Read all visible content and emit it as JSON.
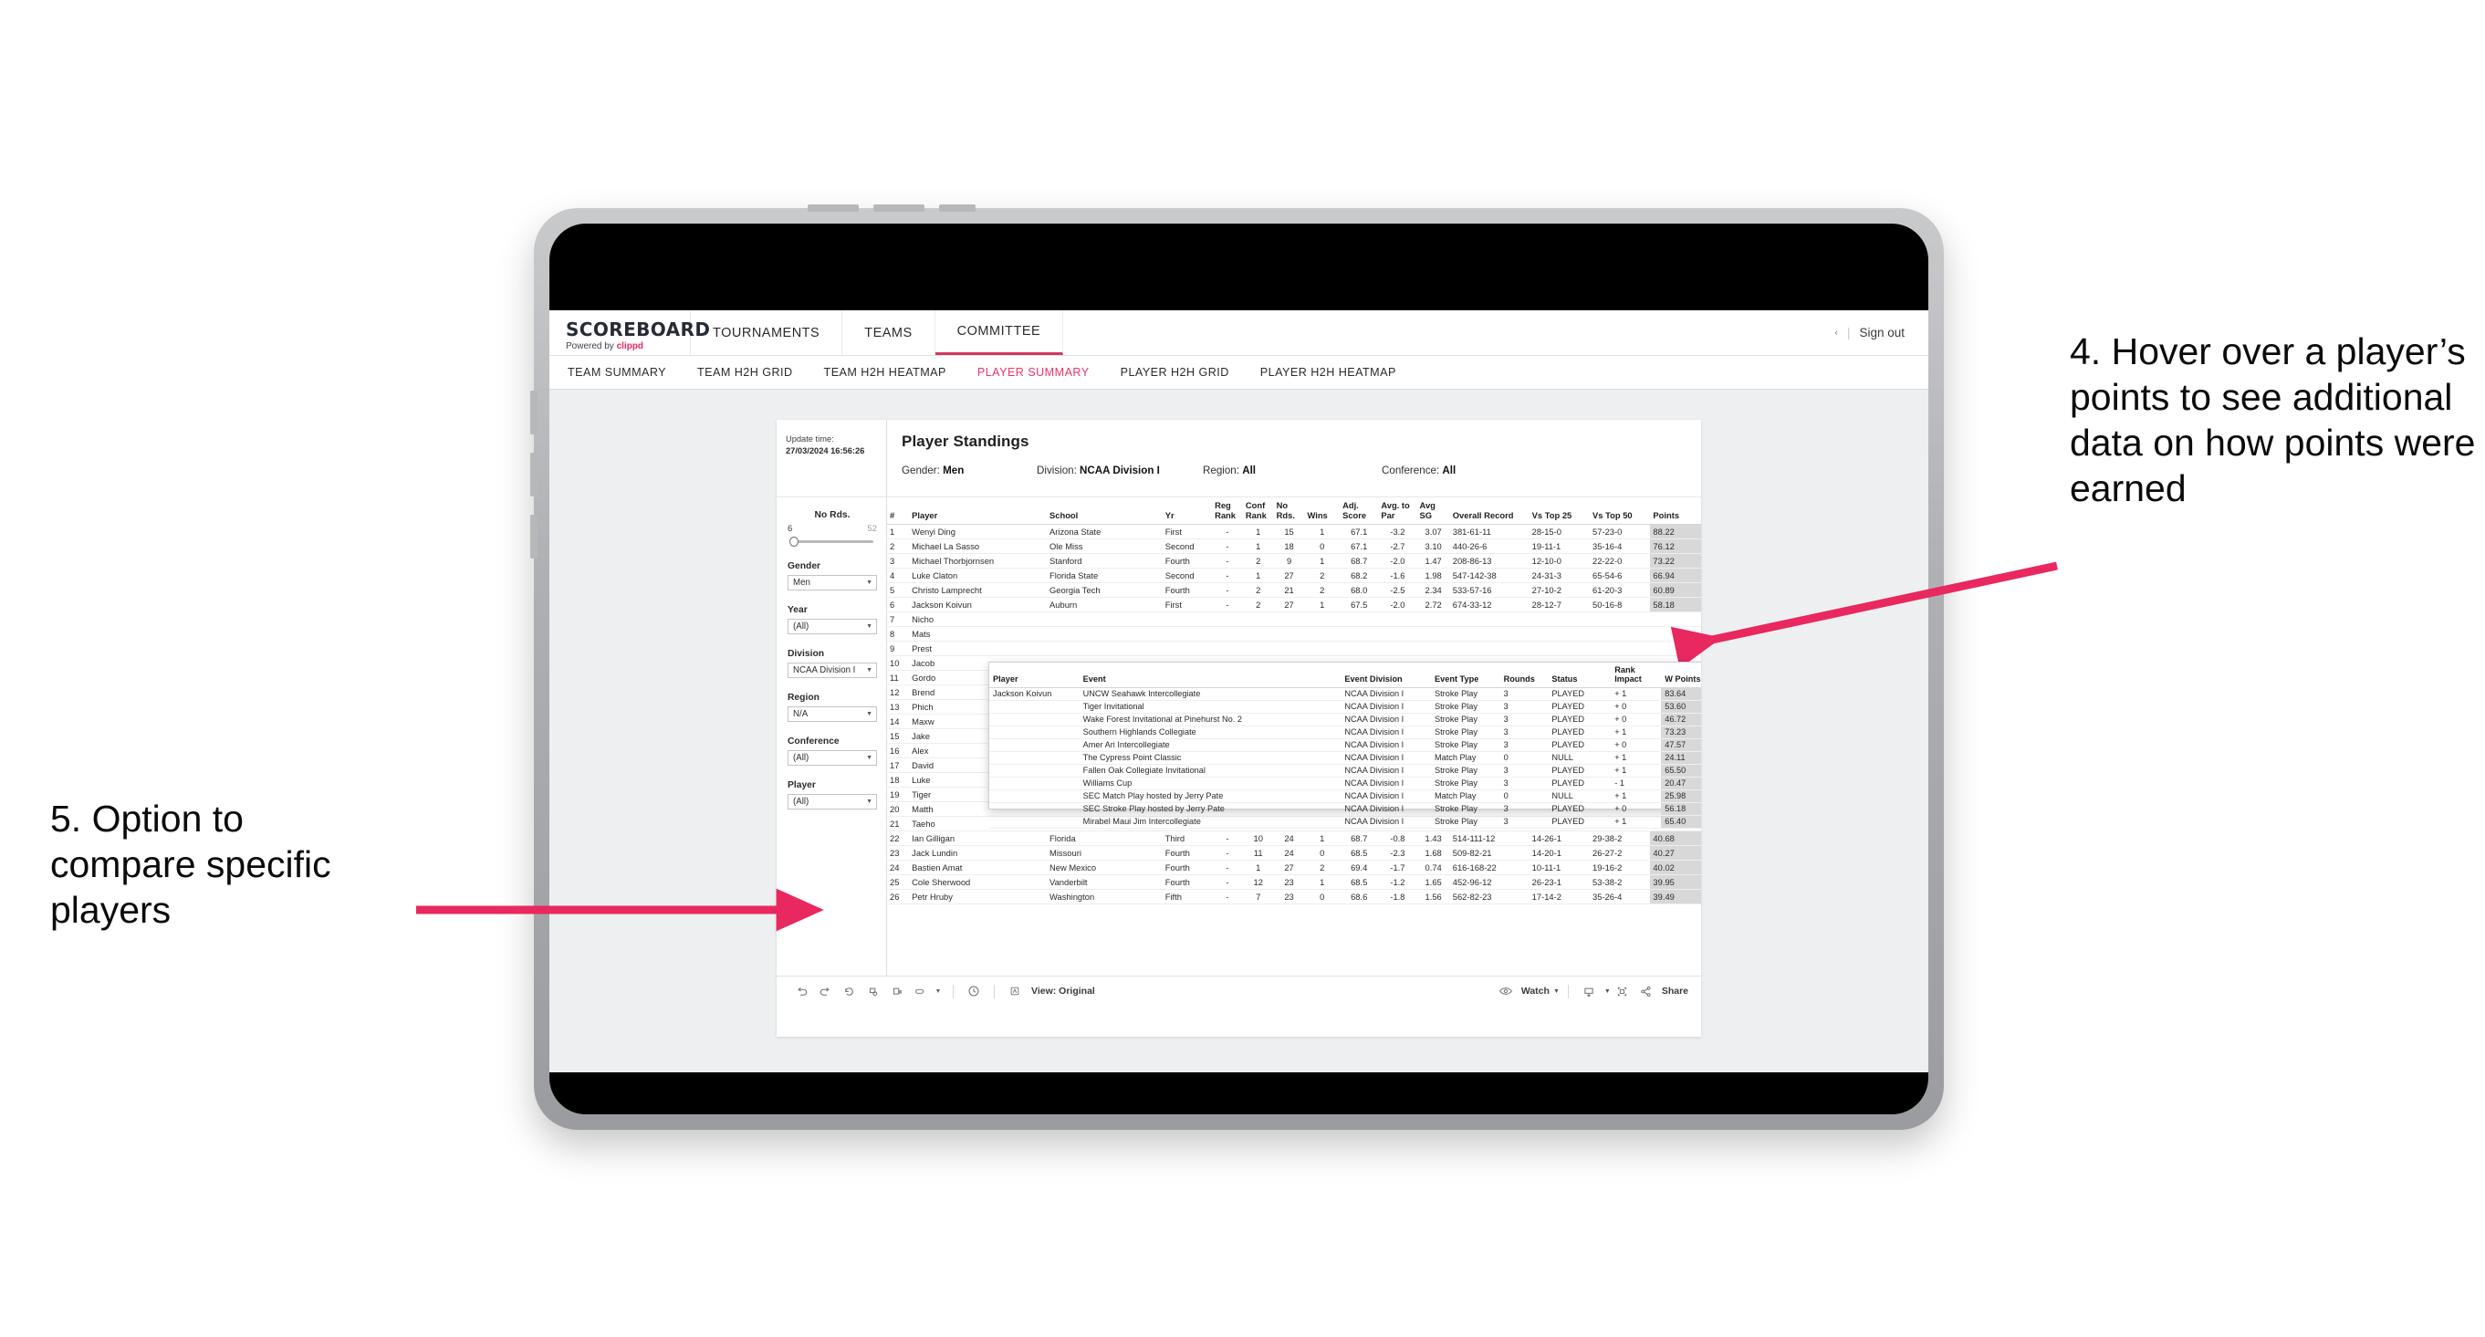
{
  "topnav": {
    "brand": {
      "title": "SCOREBOARD",
      "powered_prefix": "Powered by",
      "powered_brand": "clippd"
    },
    "tabs": [
      {
        "label": "TOURNAMENTS",
        "active": false
      },
      {
        "label": "TEAMS",
        "active": false
      },
      {
        "label": "COMMITTEE",
        "active": true
      }
    ],
    "dots": "‹",
    "separator": "|",
    "signout": "Sign out"
  },
  "subnav": {
    "items": [
      {
        "label": "TEAM SUMMARY",
        "active": false
      },
      {
        "label": "TEAM H2H GRID",
        "active": false
      },
      {
        "label": "TEAM H2H HEATMAP",
        "active": false
      },
      {
        "label": "PLAYER SUMMARY",
        "active": true
      },
      {
        "label": "PLAYER H2H GRID",
        "active": false
      },
      {
        "label": "PLAYER H2H HEATMAP",
        "active": false
      }
    ]
  },
  "viz": {
    "update_label": "Update time:",
    "update_value": "27/03/2024 16:56:26",
    "title": "Player Standings",
    "summary_filters": [
      {
        "label": "Gender:",
        "value": "Men"
      },
      {
        "label": "Division:",
        "value": "NCAA Division I"
      },
      {
        "label": "Region:",
        "value": "All"
      },
      {
        "label": "Conference:",
        "value": "All"
      }
    ],
    "sidebar": {
      "slider": {
        "label": "No Rds.",
        "min": "6",
        "max": "52"
      },
      "filters": [
        {
          "label": "Gender",
          "value": "Men"
        },
        {
          "label": "Year",
          "value": "(All)"
        },
        {
          "label": "Division",
          "value": "NCAA Division I"
        },
        {
          "label": "Region",
          "value": "N/A"
        },
        {
          "label": "Conference",
          "value": "(All)"
        },
        {
          "label": "Player",
          "value": "(All)"
        }
      ]
    },
    "table": {
      "headers": [
        "#",
        "Player",
        "School",
        "Yr",
        "Reg Rank",
        "Conf Rank",
        "No Rds.",
        "Wins",
        "Adj. Score",
        "Avg. to Par",
        "Avg SG",
        "Overall Record",
        "Vs Top 25",
        "Vs Top 50",
        "Points"
      ],
      "rows": [
        {
          "num": "1",
          "player": "Wenyi Ding",
          "school": "Arizona State",
          "yr": "First",
          "reg": "-",
          "conf": "1",
          "rds": "15",
          "wins": "1",
          "adj": "67.1",
          "par": "-3.2",
          "sg": "3.07",
          "record": "381-61-11",
          "t25": "28-15-0",
          "t50": "57-23-0",
          "points": "88.22"
        },
        {
          "num": "2",
          "player": "Michael La Sasso",
          "school": "Ole Miss",
          "yr": "Second",
          "reg": "-",
          "conf": "1",
          "rds": "18",
          "wins": "0",
          "adj": "67.1",
          "par": "-2.7",
          "sg": "3.10",
          "record": "440-26-6",
          "t25": "19-11-1",
          "t50": "35-16-4",
          "points": "76.12"
        },
        {
          "num": "3",
          "player": "Michael Thorbjornsen",
          "school": "Stanford",
          "yr": "Fourth",
          "reg": "-",
          "conf": "2",
          "rds": "9",
          "wins": "1",
          "adj": "68.7",
          "par": "-2.0",
          "sg": "1.47",
          "record": "208-86-13",
          "t25": "12-10-0",
          "t50": "22-22-0",
          "points": "73.22"
        },
        {
          "num": "4",
          "player": "Luke Claton",
          "school": "Florida State",
          "yr": "Second",
          "reg": "-",
          "conf": "1",
          "rds": "27",
          "wins": "2",
          "adj": "68.2",
          "par": "-1.6",
          "sg": "1.98",
          "record": "547-142-38",
          "t25": "24-31-3",
          "t50": "65-54-6",
          "points": "66.94"
        },
        {
          "num": "5",
          "player": "Christo Lamprecht",
          "school": "Georgia Tech",
          "yr": "Fourth",
          "reg": "-",
          "conf": "2",
          "rds": "21",
          "wins": "2",
          "adj": "68.0",
          "par": "-2.5",
          "sg": "2.34",
          "record": "533-57-16",
          "t25": "27-10-2",
          "t50": "61-20-3",
          "points": "60.89"
        },
        {
          "num": "6",
          "player": "Jackson Koivun",
          "school": "Auburn",
          "yr": "First",
          "reg": "-",
          "conf": "2",
          "rds": "27",
          "wins": "1",
          "adj": "67.5",
          "par": "-2.0",
          "sg": "2.72",
          "record": "674-33-12",
          "t25": "28-12-7",
          "t50": "50-16-8",
          "points": "58.18"
        },
        {
          "num": "7",
          "player": "Nicho",
          "school": "",
          "yr": "",
          "reg": "",
          "conf": "",
          "rds": "",
          "wins": "",
          "adj": "",
          "par": "",
          "sg": "",
          "record": "",
          "t25": "",
          "t50": "",
          "points": ""
        },
        {
          "num": "8",
          "player": "Mats",
          "school": "",
          "yr": "",
          "reg": "",
          "conf": "",
          "rds": "",
          "wins": "",
          "adj": "",
          "par": "",
          "sg": "",
          "record": "",
          "t25": "",
          "t50": "",
          "points": ""
        },
        {
          "num": "9",
          "player": "Prest",
          "school": "",
          "yr": "",
          "reg": "",
          "conf": "",
          "rds": "",
          "wins": "",
          "adj": "",
          "par": "",
          "sg": "",
          "record": "",
          "t25": "",
          "t50": "",
          "points": ""
        },
        {
          "num": "10",
          "player": "Jacob",
          "school": "",
          "yr": "",
          "reg": "",
          "conf": "",
          "rds": "",
          "wins": "",
          "adj": "",
          "par": "",
          "sg": "",
          "record": "",
          "t25": "",
          "t50": "",
          "points": ""
        },
        {
          "num": "11",
          "player": "Gordo",
          "school": "",
          "yr": "",
          "reg": "",
          "conf": "",
          "rds": "",
          "wins": "",
          "adj": "",
          "par": "",
          "sg": "",
          "record": "",
          "t25": "",
          "t50": "",
          "points": ""
        },
        {
          "num": "12",
          "player": "Brend",
          "school": "",
          "yr": "",
          "reg": "",
          "conf": "",
          "rds": "",
          "wins": "",
          "adj": "",
          "par": "",
          "sg": "",
          "record": "",
          "t25": "",
          "t50": "",
          "points": ""
        },
        {
          "num": "13",
          "player": "Phich",
          "school": "",
          "yr": "",
          "reg": "",
          "conf": "",
          "rds": "",
          "wins": "",
          "adj": "",
          "par": "",
          "sg": "",
          "record": "",
          "t25": "",
          "t50": "",
          "points": ""
        },
        {
          "num": "14",
          "player": "Maxw",
          "school": "",
          "yr": "",
          "reg": "",
          "conf": "",
          "rds": "",
          "wins": "",
          "adj": "",
          "par": "",
          "sg": "",
          "record": "",
          "t25": "",
          "t50": "",
          "points": ""
        },
        {
          "num": "15",
          "player": "Jake",
          "school": "",
          "yr": "",
          "reg": "",
          "conf": "",
          "rds": "",
          "wins": "",
          "adj": "",
          "par": "",
          "sg": "",
          "record": "",
          "t25": "",
          "t50": "",
          "points": ""
        },
        {
          "num": "16",
          "player": "Alex",
          "school": "",
          "yr": "",
          "reg": "",
          "conf": "",
          "rds": "",
          "wins": "",
          "adj": "",
          "par": "",
          "sg": "",
          "record": "",
          "t25": "",
          "t50": "",
          "points": ""
        },
        {
          "num": "17",
          "player": "David",
          "school": "",
          "yr": "",
          "reg": "",
          "conf": "",
          "rds": "",
          "wins": "",
          "adj": "",
          "par": "",
          "sg": "",
          "record": "",
          "t25": "",
          "t50": "",
          "points": ""
        },
        {
          "num": "18",
          "player": "Luke",
          "school": "",
          "yr": "",
          "reg": "",
          "conf": "",
          "rds": "",
          "wins": "",
          "adj": "",
          "par": "",
          "sg": "",
          "record": "",
          "t25": "",
          "t50": "",
          "points": ""
        },
        {
          "num": "19",
          "player": "Tiger",
          "school": "",
          "yr": "",
          "reg": "",
          "conf": "",
          "rds": "",
          "wins": "",
          "adj": "",
          "par": "",
          "sg": "",
          "record": "",
          "t25": "",
          "t50": "",
          "points": ""
        },
        {
          "num": "20",
          "player": "Matth",
          "school": "",
          "yr": "",
          "reg": "",
          "conf": "",
          "rds": "",
          "wins": "",
          "adj": "",
          "par": "",
          "sg": "",
          "record": "",
          "t25": "",
          "t50": "",
          "points": ""
        },
        {
          "num": "21",
          "player": "Taeho",
          "school": "",
          "yr": "",
          "reg": "",
          "conf": "",
          "rds": "",
          "wins": "",
          "adj": "",
          "par": "",
          "sg": "",
          "record": "",
          "t25": "",
          "t50": "",
          "points": ""
        },
        {
          "num": "22",
          "player": "Ian Gilligan",
          "school": "Florida",
          "yr": "Third",
          "reg": "-",
          "conf": "10",
          "rds": "24",
          "wins": "1",
          "adj": "68.7",
          "par": "-0.8",
          "sg": "1.43",
          "record": "514-111-12",
          "t25": "14-26-1",
          "t50": "29-38-2",
          "points": "40.68"
        },
        {
          "num": "23",
          "player": "Jack Lundin",
          "school": "Missouri",
          "yr": "Fourth",
          "reg": "-",
          "conf": "11",
          "rds": "24",
          "wins": "0",
          "adj": "68.5",
          "par": "-2.3",
          "sg": "1.68",
          "record": "509-82-21",
          "t25": "14-20-1",
          "t50": "26-27-2",
          "points": "40.27"
        },
        {
          "num": "24",
          "player": "Bastien Amat",
          "school": "New Mexico",
          "yr": "Fourth",
          "reg": "-",
          "conf": "1",
          "rds": "27",
          "wins": "2",
          "adj": "69.4",
          "par": "-1.7",
          "sg": "0.74",
          "record": "616-168-22",
          "t25": "10-11-1",
          "t50": "19-16-2",
          "points": "40.02"
        },
        {
          "num": "25",
          "player": "Cole Sherwood",
          "school": "Vanderbilt",
          "yr": "Fourth",
          "reg": "-",
          "conf": "12",
          "rds": "23",
          "wins": "1",
          "adj": "68.5",
          "par": "-1.2",
          "sg": "1.65",
          "record": "452-96-12",
          "t25": "26-23-1",
          "t50": "53-38-2",
          "points": "39.95"
        },
        {
          "num": "26",
          "player": "Petr Hruby",
          "school": "Washington",
          "yr": "Fifth",
          "reg": "-",
          "conf": "7",
          "rds": "23",
          "wins": "0",
          "adj": "68.6",
          "par": "-1.8",
          "sg": "1.56",
          "record": "562-82-23",
          "t25": "17-14-2",
          "t50": "35-26-4",
          "points": "39.49"
        }
      ]
    },
    "tooltip": {
      "headers": [
        "Player",
        "Event",
        "Event Division",
        "Event Type",
        "Rounds",
        "Status",
        "Rank Impact",
        "W Points"
      ],
      "player": "Jackson Koivun",
      "rows": [
        {
          "event": "UNCW Seahawk Intercollegiate",
          "division": "NCAA Division I",
          "type": "Stroke Play",
          "rounds": "3",
          "status": "PLAYED",
          "impact": "+ 1",
          "wpoints": "83.64"
        },
        {
          "event": "Tiger Invitational",
          "division": "NCAA Division I",
          "type": "Stroke Play",
          "rounds": "3",
          "status": "PLAYED",
          "impact": "+ 0",
          "wpoints": "53.60"
        },
        {
          "event": "Wake Forest Invitational at Pinehurst No. 2",
          "division": "NCAA Division I",
          "type": "Stroke Play",
          "rounds": "3",
          "status": "PLAYED",
          "impact": "+ 0",
          "wpoints": "46.72"
        },
        {
          "event": "Southern Highlands Collegiate",
          "division": "NCAA Division I",
          "type": "Stroke Play",
          "rounds": "3",
          "status": "PLAYED",
          "impact": "+ 1",
          "wpoints": "73.23"
        },
        {
          "event": "Amer Ari Intercollegiate",
          "division": "NCAA Division I",
          "type": "Stroke Play",
          "rounds": "3",
          "status": "PLAYED",
          "impact": "+ 0",
          "wpoints": "47.57"
        },
        {
          "event": "The Cypress Point Classic",
          "division": "NCAA Division I",
          "type": "Match Play",
          "rounds": "0",
          "status": "NULL",
          "impact": "+ 1",
          "wpoints": "24.11"
        },
        {
          "event": "Fallen Oak Collegiate Invitational",
          "division": "NCAA Division I",
          "type": "Stroke Play",
          "rounds": "3",
          "status": "PLAYED",
          "impact": "+ 1",
          "wpoints": "65.50"
        },
        {
          "event": "Williams Cup",
          "division": "NCAA Division I",
          "type": "Stroke Play",
          "rounds": "3",
          "status": "PLAYED",
          "impact": "- 1",
          "wpoints": "20.47"
        },
        {
          "event": "SEC Match Play hosted by Jerry Pate",
          "division": "NCAA Division I",
          "type": "Match Play",
          "rounds": "0",
          "status": "NULL",
          "impact": "+ 1",
          "wpoints": "25.98"
        },
        {
          "event": "SEC Stroke Play hosted by Jerry Pate",
          "division": "NCAA Division I",
          "type": "Stroke Play",
          "rounds": "3",
          "status": "PLAYED",
          "impact": "+ 0",
          "wpoints": "56.18"
        },
        {
          "event": "Mirabel Maui Jim Intercollegiate",
          "division": "NCAA Division I",
          "type": "Stroke Play",
          "rounds": "3",
          "status": "PLAYED",
          "impact": "+ 1",
          "wpoints": "65.40"
        }
      ]
    },
    "toolbar": {
      "view_label": "View: Original",
      "watch_label": "Watch",
      "share_label": "Share"
    }
  },
  "annotations": {
    "right": "4. Hover over a player’s points to see additional data on how points were earned",
    "left": "5. Option to compare specific players",
    "arrow_color": "#e8285f"
  }
}
